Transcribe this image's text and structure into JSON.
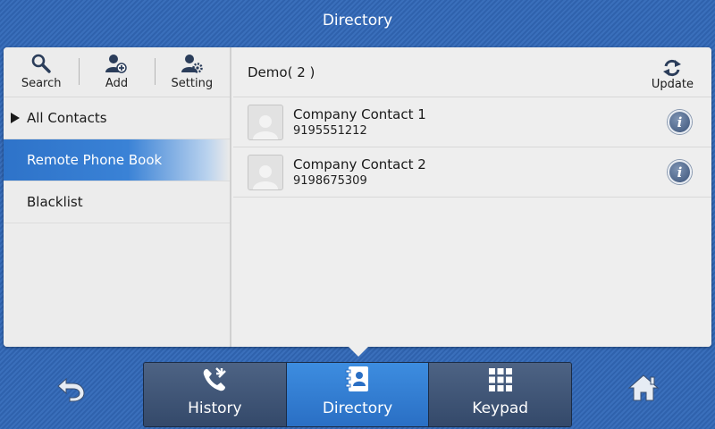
{
  "title": "Directory",
  "toolbar": {
    "search_label": "Search",
    "add_label": "Add",
    "setting_label": "Setting"
  },
  "nav": {
    "items": [
      {
        "label": "All Contacts"
      },
      {
        "label": "Remote Phone Book"
      },
      {
        "label": "Blacklist"
      }
    ]
  },
  "group": {
    "title": "Demo( 2 )",
    "update_label": "Update"
  },
  "contacts": [
    {
      "name": "Company Contact 1",
      "number": "9195551212"
    },
    {
      "name": "Company Contact 2",
      "number": "9198675309"
    }
  ],
  "tabs": {
    "history": "History",
    "directory": "Directory",
    "keypad": "Keypad"
  },
  "icons": {
    "search": "search-icon",
    "add": "add-contact-icon",
    "setting": "contact-setting-icon",
    "update": "refresh-icon",
    "info": "info-icon",
    "back": "back-arrow-icon",
    "home": "home-icon",
    "history": "call-history-icon",
    "directory": "address-book-icon",
    "keypad": "keypad-icon"
  },
  "colors": {
    "accent": "#2e73c9",
    "background": "#2f62ad",
    "panel": "#eeeeee"
  }
}
